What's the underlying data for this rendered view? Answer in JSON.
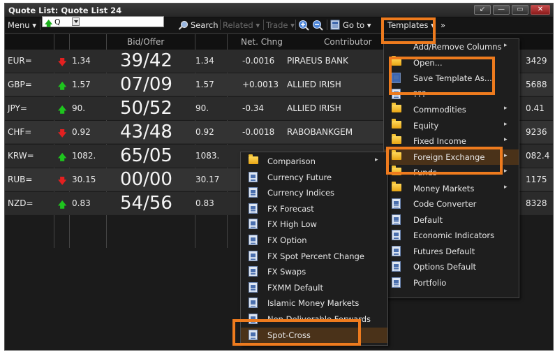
{
  "window": {
    "title": "Quote List: Quote List 24",
    "buttons": [
      "↙",
      "—",
      "▭",
      "✕"
    ]
  },
  "toolbar": {
    "menu_label": "Menu ▾",
    "ric_value": "Q",
    "search_label": "Search",
    "related_label": "Related ▾",
    "trade_label": "Trade ▾",
    "goto_label": "Go to ▾",
    "templates_label": "Templates ▾",
    "more_label": "»"
  },
  "columns": {
    "bid_offer": "Bid/Offer",
    "net_chng": "Net. Chng",
    "contributor": "Contributor"
  },
  "rows": [
    {
      "ric": "EUR=",
      "dir": "down",
      "bid": "1.34",
      "big": "39/42",
      "offer": "1.34",
      "chng": "-0.0016",
      "contrib": "PIRAEUS BANK",
      "extra": "3429"
    },
    {
      "ric": "GBP=",
      "dir": "up",
      "bid": "1.57",
      "big": "07/09",
      "offer": "1.57",
      "chng": "+0.0013",
      "contrib": "ALLIED IRISH",
      "extra": "5688"
    },
    {
      "ric": "JPY=",
      "dir": "up",
      "bid": "90.",
      "big": "50/52",
      "offer": "90.",
      "chng": "-0.34",
      "contrib": "ALLIED IRISH",
      "extra": "0.41"
    },
    {
      "ric": "CHF=",
      "dir": "down",
      "bid": "0.92",
      "big": "43/48",
      "offer": "0.92",
      "chng": "-0.0018",
      "contrib": "RABOBANKGEM",
      "extra": "9236"
    },
    {
      "ric": "KRW=",
      "dir": "up",
      "bid": "1082.",
      "big": "65/05",
      "offer": "1083.",
      "chng": "",
      "contrib": "",
      "extra": "082.4"
    },
    {
      "ric": "RUB=",
      "dir": "down",
      "bid": "30.15",
      "big": "00/00",
      "offer": "30.17",
      "chng": "",
      "contrib": "",
      "extra": "1175"
    },
    {
      "ric": "NZD=",
      "dir": "up",
      "bid": "0.83",
      "big": "54/56",
      "offer": "0.83",
      "chng": "",
      "contrib": "",
      "extra": "8328"
    }
  ],
  "templates_menu": {
    "items": [
      {
        "label": "Add/Remove Columns",
        "icon": "none",
        "submenu": true
      },
      {
        "label": "Open...",
        "icon": "open-folder-icon",
        "submenu": false
      },
      {
        "label": "Save Template As...",
        "icon": "save-icon",
        "submenu": false
      },
      {
        "label": "???",
        "icon": "document-icon",
        "submenu": false
      },
      {
        "label": "Commodities",
        "icon": "folder-icon",
        "submenu": true
      },
      {
        "label": "Equity",
        "icon": "folder-icon",
        "submenu": true
      },
      {
        "label": "Fixed Income",
        "icon": "folder-icon",
        "submenu": true
      },
      {
        "label": "Foreign Exchange",
        "icon": "folder-icon",
        "submenu": true
      },
      {
        "label": "Funds",
        "icon": "folder-icon",
        "submenu": true
      },
      {
        "label": "Money Markets",
        "icon": "folder-icon",
        "submenu": true
      },
      {
        "label": "Code Converter",
        "icon": "document-icon",
        "submenu": false
      },
      {
        "label": "Default",
        "icon": "document-icon",
        "submenu": false
      },
      {
        "label": "Economic Indicators",
        "icon": "document-icon",
        "submenu": false
      },
      {
        "label": "Futures Default",
        "icon": "document-icon",
        "submenu": false
      },
      {
        "label": "Options Default",
        "icon": "document-icon",
        "submenu": false
      },
      {
        "label": "Portfolio",
        "icon": "document-icon",
        "submenu": false
      }
    ]
  },
  "fx_menu": {
    "items": [
      {
        "label": "Comparison",
        "icon": "folder-icon",
        "submenu": true
      },
      {
        "label": "Currency Future",
        "icon": "document-icon",
        "submenu": false
      },
      {
        "label": "Currency Indices",
        "icon": "document-icon",
        "submenu": false
      },
      {
        "label": "FX Forecast",
        "icon": "document-icon",
        "submenu": false
      },
      {
        "label": "FX High Low",
        "icon": "document-icon",
        "submenu": false
      },
      {
        "label": "FX Option",
        "icon": "document-icon",
        "submenu": false
      },
      {
        "label": "FX Spot Percent Change",
        "icon": "document-icon",
        "submenu": false
      },
      {
        "label": "FX Swaps",
        "icon": "document-icon",
        "submenu": false
      },
      {
        "label": "FXMM Default",
        "icon": "document-icon",
        "submenu": false
      },
      {
        "label": "Islamic Money Markets",
        "icon": "document-icon",
        "submenu": false
      },
      {
        "label": "Non Deliverable Forwards",
        "icon": "document-icon",
        "submenu": false
      },
      {
        "label": "Spot-Cross",
        "icon": "document-icon",
        "submenu": false
      }
    ]
  },
  "colors": {
    "highlight_border": "#ee7b1e",
    "up_arrow": "#1ec51e",
    "down_arrow": "#e32020"
  }
}
